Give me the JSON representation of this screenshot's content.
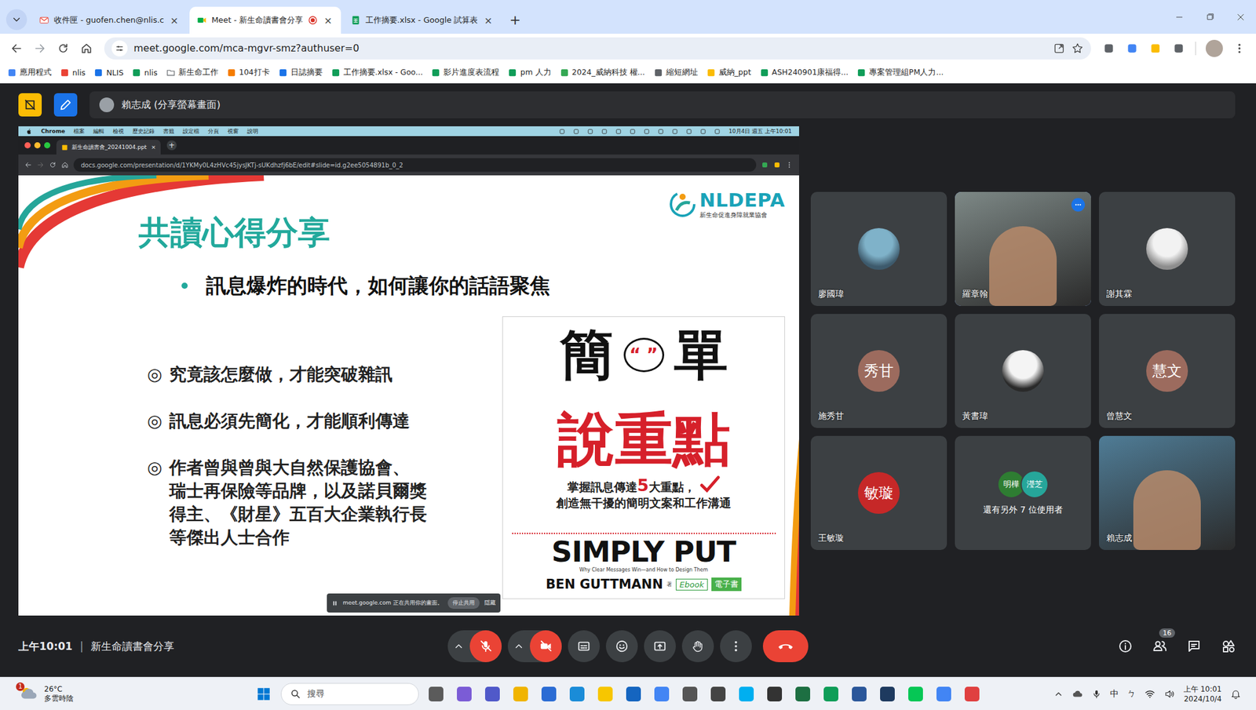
{
  "browser": {
    "tabs": [
      {
        "label": "收件匣 - guofen.chen@nlis.c",
        "selected": false,
        "recording": false
      },
      {
        "label": "Meet - 新生命讀書會分享",
        "selected": true,
        "recording": true
      },
      {
        "label": "工作摘要.xlsx - Google 試算表",
        "selected": false,
        "recording": false
      }
    ],
    "close_glyph": "×",
    "new_tab": "+",
    "url": "meet.google.com/mca-mgvr-smz?authuser=0",
    "bookmarks": [
      "應用程式",
      "nlis",
      "NLIS",
      "nlis",
      "新生命工作",
      "104打卡",
      "日誌摘要",
      "工作摘要.xlsx - Goo...",
      "影片進度表流程",
      "pm 人力",
      "2024_威納科技 權...",
      "縮短網址",
      "威納_ppt",
      "ASH240901康福得...",
      "專案管理組PM人力..."
    ]
  },
  "meet": {
    "presenter_label": "賴志成 (分享螢幕畫面)",
    "shared_screen": {
      "menubar": {
        "app": "Chrome",
        "items": [
          "檔案",
          "編輯",
          "檢視",
          "歷史記錄",
          "書籤",
          "設定檔",
          "分頁",
          "視窗",
          "說明"
        ],
        "clock": "10月4日 週五 上午10:01"
      },
      "tab": "新生命讀書會_20241004.ppt",
      "close": "×",
      "new_tab": "+",
      "url": "docs.google.com/presentation/d/1YKMy0L4zHVc45jysJKTj-sUKdhzfj6bE/edit#slide=id.g2ee5054891b_0_2",
      "slide": {
        "title": "共讀心得分享",
        "logo": {
          "name": "NLDEPA",
          "subtitle": "新生命促進身障就業協會"
        },
        "headline": "訊息爆炸的時代，如何讓你的話語聚焦",
        "points": [
          {
            "mark": "◎",
            "lines": [
              "究竟該怎麼做，才能突破雜訊"
            ]
          },
          {
            "mark": "◎",
            "lines": [
              "訊息必須先簡化，才能順利傳達"
            ]
          },
          {
            "mark": "◎",
            "lines": [
              "作者曾與曾與大自然保護協會、",
              "瑞士再保險等品牌，以及諾貝爾獎",
              "得主、《財星》五百大企業執行長",
              "等傑出人士合作"
            ]
          }
        ],
        "book": {
          "title_top": [
            "簡",
            "單"
          ],
          "bubble_quote": "“ ”",
          "title_main": "說重點",
          "tagline": [
            "掌握訊息傳達",
            "5",
            "大重點，"
          ],
          "tagline2": "創造無干擾的簡明文案和工作溝通",
          "english_title": "SIMPLY PUT",
          "english_subtitle": "Why Clear Messages Win—and How to Design Them",
          "author": "BEN GUTTMANN",
          "author_suffix": "著",
          "badge_en": "Ebook",
          "badge_zh": "電子書"
        }
      },
      "share_notice": {
        "text": "meet.google.com 正在共用你的畫面。",
        "stop": "停止共用",
        "hide": "隱藏"
      }
    },
    "participants": [
      {
        "name": "廖國瑋",
        "kind": "photo",
        "speaking": false
      },
      {
        "name": "羅章翰",
        "kind": "video",
        "speaking": true
      },
      {
        "name": "謝其霖",
        "kind": "photo",
        "speaking": false
      },
      {
        "name": "施秀甘",
        "kind": "initials",
        "initials": "秀甘",
        "color": "#9c6b5e",
        "speaking": false
      },
      {
        "name": "黃書瑋",
        "kind": "photo",
        "speaking": false
      },
      {
        "name": "曾慧文",
        "kind": "initials",
        "initials": "慧文",
        "color": "#9c6b5e",
        "speaking": false
      },
      {
        "name": "王敏璇",
        "kind": "initials",
        "initials": "敏璇",
        "color": "#c62828",
        "speaking": false
      },
      {
        "name": "還有另外 7 位使用者",
        "kind": "overflow",
        "speaking": false,
        "avatars": [
          {
            "initials": "明樺",
            "color": "#2e7d32"
          },
          {
            "initials": "瀅芝",
            "color": "#26a69a"
          }
        ]
      },
      {
        "name": "賴志成",
        "kind": "video",
        "speaking": false
      }
    ],
    "meeting_time": "上午10:01",
    "separator": "|",
    "meeting_title": "新生命讀書會分享",
    "controls": {
      "mic_muted": true,
      "camera_off": true
    },
    "people_count": "16"
  },
  "taskbar": {
    "weather": {
      "temp": "26°C",
      "desc": "多雲時陰",
      "badge": "1"
    },
    "search": "搜尋",
    "ime": "中",
    "ime_mode": "ㄅ",
    "time": "上午 10:01",
    "date": "2024/10/4"
  }
}
